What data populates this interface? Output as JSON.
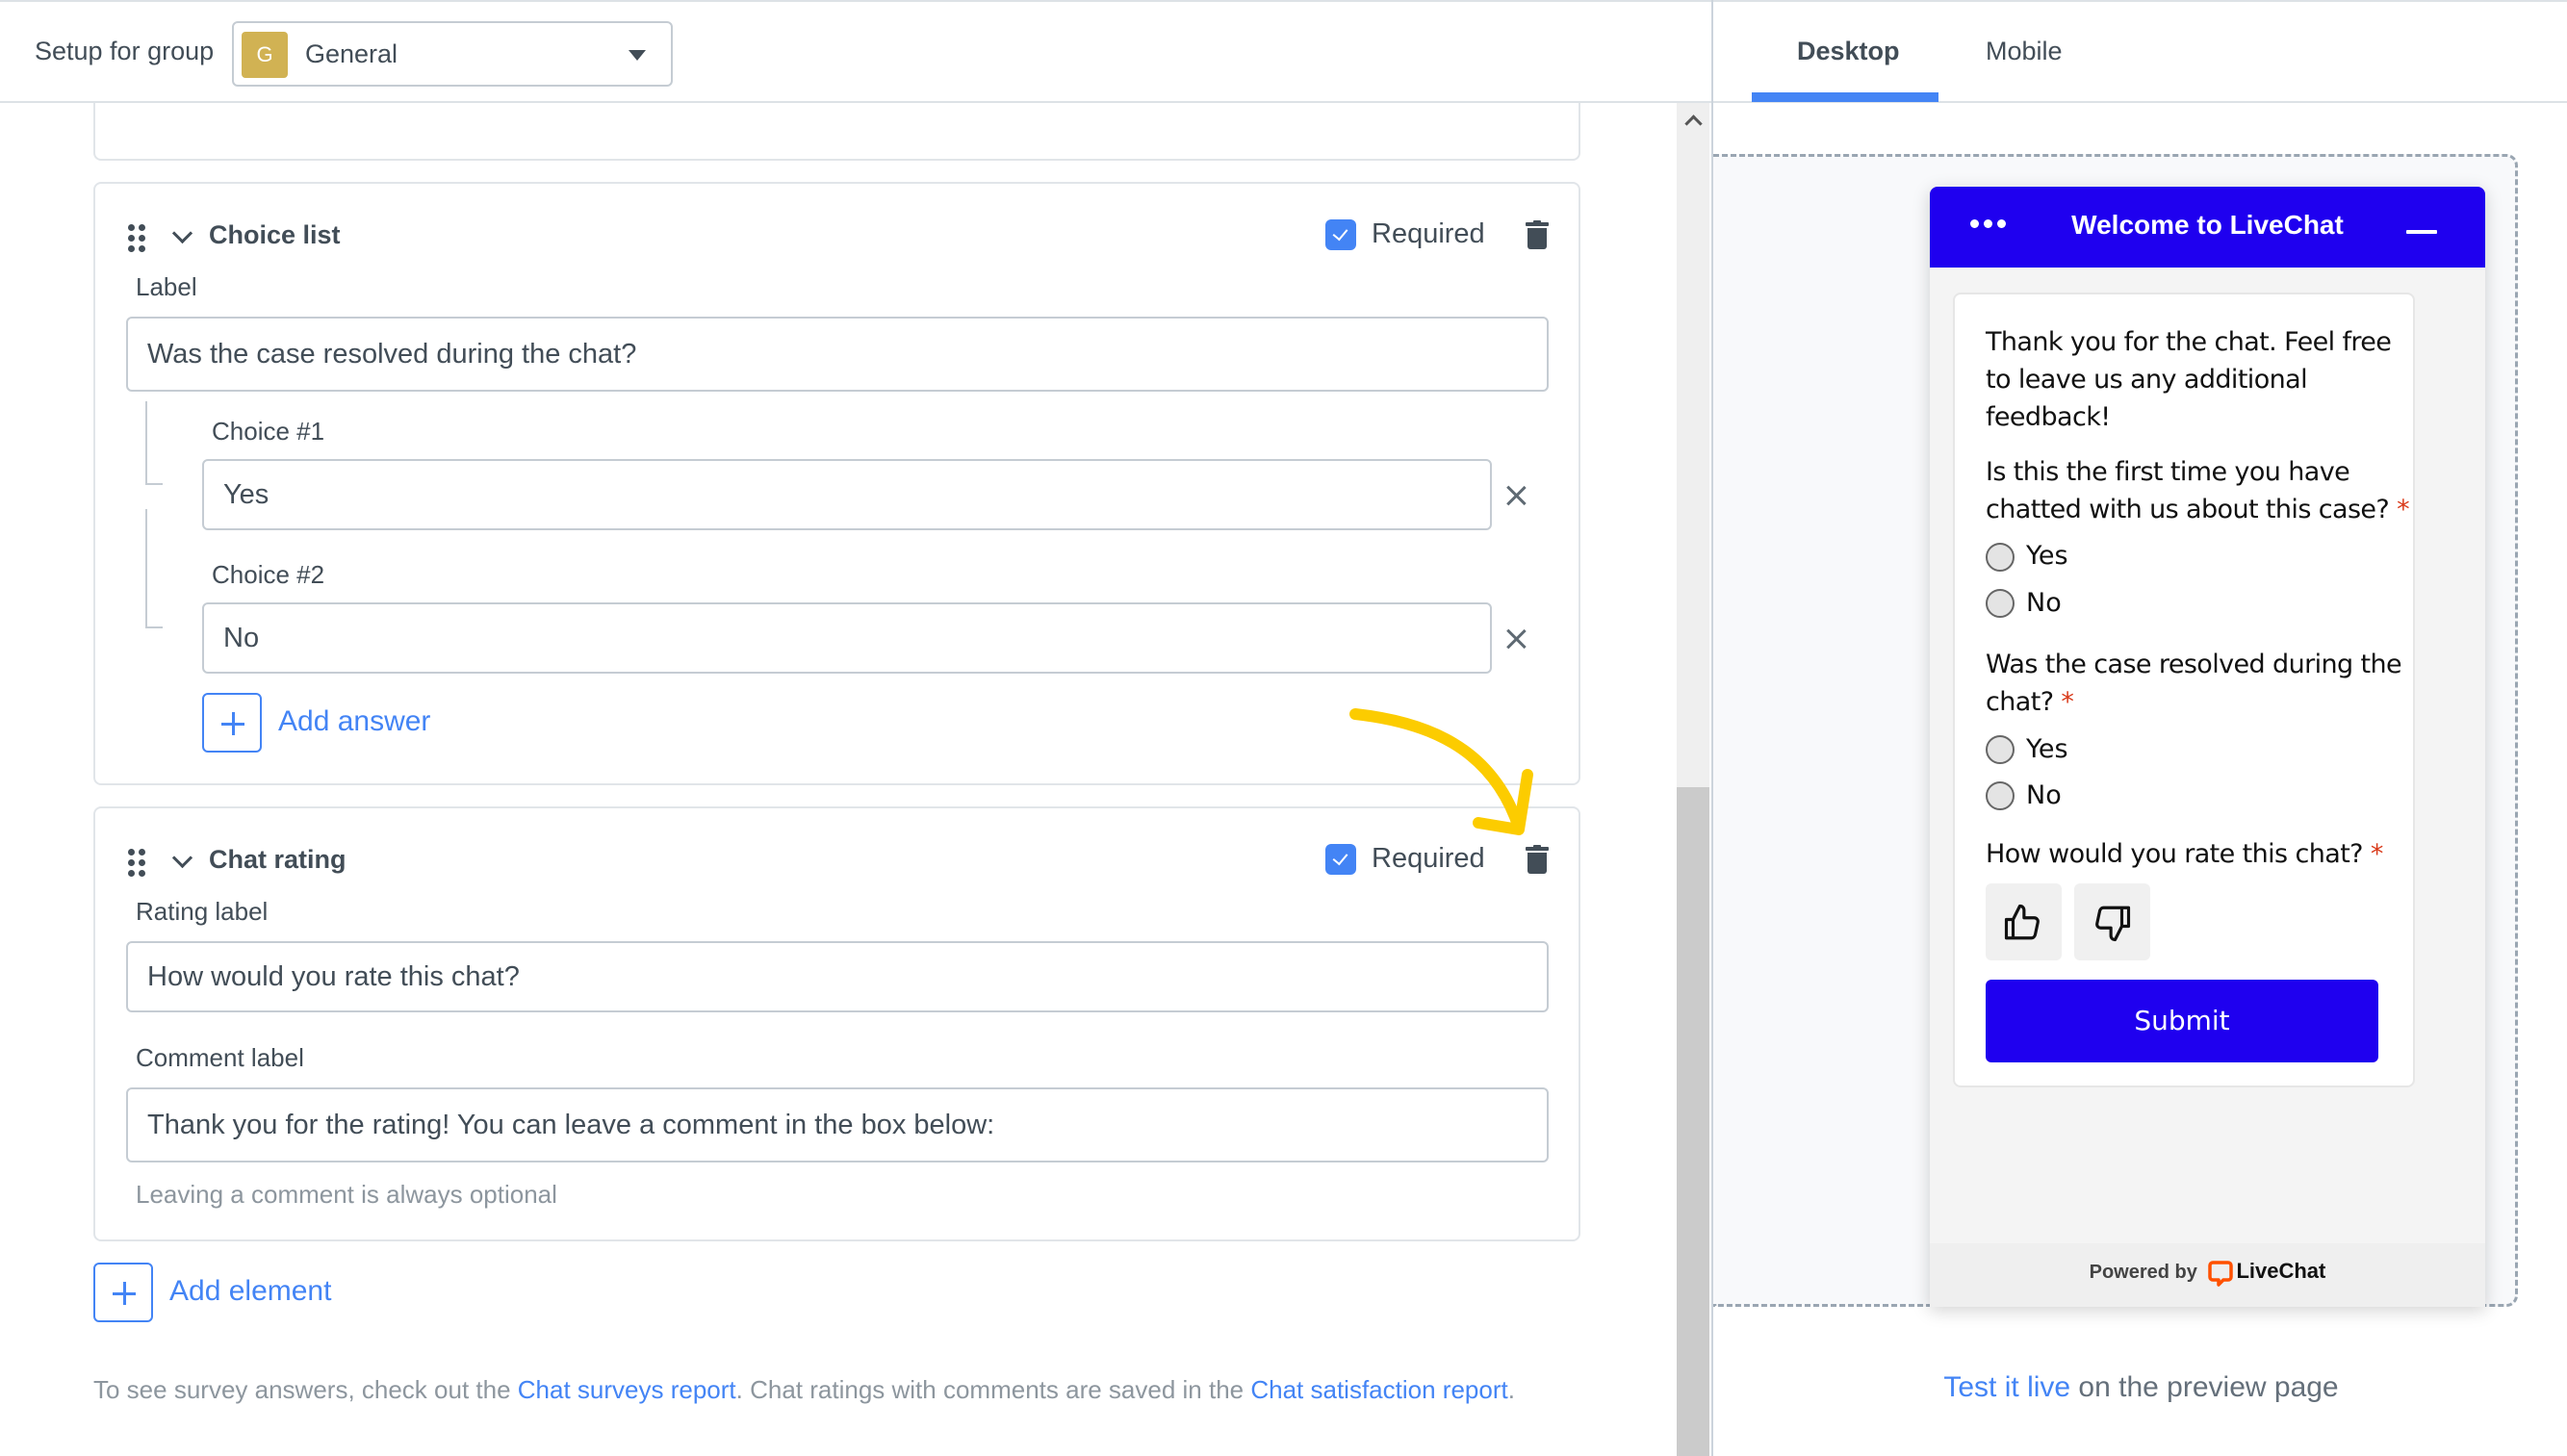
{
  "topbar": {
    "setup_label": "Setup for group",
    "group_badge": "G",
    "group_value": "General",
    "group_badge_color": "#d1b253"
  },
  "cards": {
    "previous": {
      "add_answer_label": "Add answer"
    },
    "choice_list": {
      "title": "Choice list",
      "required_label": "Required",
      "required_checked": true,
      "label_field_label": "Label",
      "label_value": "Was the case resolved during the chat?",
      "choices": [
        {
          "label": "Choice #1",
          "value": "Yes"
        },
        {
          "label": "Choice #2",
          "value": "No"
        }
      ],
      "add_answer_label": "Add answer"
    },
    "chat_rating": {
      "title": "Chat rating",
      "required_label": "Required",
      "required_checked": true,
      "rating_label_label": "Rating label",
      "rating_label_value": "How would you rate this chat?",
      "comment_label_label": "Comment label",
      "comment_label_value": "Thank you for the rating! You can leave a comment in the box below:",
      "comment_hint": "Leaving a comment is always optional"
    }
  },
  "add_element_label": "Add element",
  "footer": {
    "text_1": "To see survey answers, check out the ",
    "link_1": "Chat surveys report",
    "text_2": ". Chat ratings with comments are saved in the ",
    "link_2": "Chat satisfaction report",
    "text_3": "."
  },
  "preview": {
    "tabs": [
      {
        "label": "Desktop",
        "active": true
      },
      {
        "label": "Mobile",
        "active": false
      }
    ],
    "widget": {
      "title": "Welcome to LiveChat",
      "header_color": "#1f00ef",
      "intro_line_1": "Thank you for the chat. Feel free",
      "intro_line_2": "to leave us any additional",
      "intro_line_3": "feedback!",
      "q1_line_1": "Is this the first time you have",
      "q1_line_2": "chatted with us about this case?",
      "q1_options": [
        "Yes",
        "No"
      ],
      "q2_line_1": "Was the case resolved during the",
      "q2_line_2": "chat?",
      "q2_options": [
        "Yes",
        "No"
      ],
      "q3": "How would you rate this chat?",
      "required_mark": "*",
      "submit_label": "Submit",
      "powered_by": "Powered by",
      "brand": "LiveChat"
    },
    "test_live_link": "Test it live",
    "test_live_rest": " on the preview page"
  },
  "annotation": {
    "arrow_color": "#fccc00"
  }
}
